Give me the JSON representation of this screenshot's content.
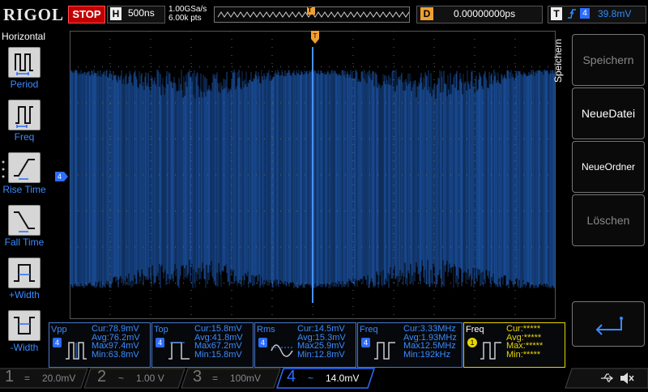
{
  "topbar": {
    "logo": "RIGOL",
    "run_state": "STOP",
    "h_label": "H",
    "timebase": "500ns",
    "sample_rate": "1.00GSa/s",
    "memory_depth": "6.00k pts",
    "trigger_marker": "T",
    "delay_label": "D",
    "delay_value": "0.00000000ps",
    "trigger_label": "T",
    "trigger_edge": "rising-edge-icon",
    "trigger_channel": "4",
    "trigger_level": "39.8mV"
  },
  "left_menu": {
    "title": "Horizontal",
    "items": [
      {
        "label": "Period",
        "icon": "period-icon"
      },
      {
        "label": "Freq",
        "icon": "frequency-icon"
      },
      {
        "label": "Rise Time",
        "icon": "rise-time-icon"
      },
      {
        "label": "Fall Time",
        "icon": "fall-time-icon"
      },
      {
        "label": "+Width",
        "icon": "positive-width-icon"
      },
      {
        "label": "-Width",
        "icon": "negative-width-icon"
      }
    ]
  },
  "channel_marker": "4",
  "right_menu": {
    "tab": "Speichern",
    "buttons": [
      {
        "label": "Speichern",
        "enabled": false
      },
      {
        "label": "NeueDatei",
        "enabled": true
      },
      {
        "label": "NeueOrdner",
        "enabled": true
      },
      {
        "label": "Löschen",
        "enabled": false
      }
    ],
    "enter_icon": "enter-return-icon"
  },
  "measurements": [
    {
      "name": "Vpp",
      "channel": "4",
      "cur": "Cur:78.9mV",
      "avg": "Avg:76.2mV",
      "max": "Max97.4mV",
      "min": "Min:63.8mV"
    },
    {
      "name": "Top",
      "channel": "4",
      "cur": "Cur:15.8mV",
      "avg": "Avg:41.8mV",
      "max": "Max67.2mV",
      "min": "Min:15.8mV"
    },
    {
      "name": "Rms",
      "channel": "4",
      "cur": "Cur:14.5mV",
      "avg": "Avg:15.3mV",
      "max": "Max25.9mV",
      "min": "Min:12.8mV"
    },
    {
      "name": "Freq",
      "channel": "4",
      "cur": "Cur:3.33MHz",
      "avg": "Avg:1.93MHz",
      "max": "Max12.5MHz",
      "min": "Min:192kHz"
    },
    {
      "name": "Freq",
      "channel": "1",
      "cur": "Cur:*****",
      "avg": "Avg:*****",
      "max": "Max:*****",
      "min": "Min:*****"
    }
  ],
  "channels": [
    {
      "num": "1",
      "coupling": "=",
      "scale": "20.0mV",
      "color": "#e8d600",
      "active": false
    },
    {
      "num": "2",
      "coupling": "~",
      "scale": "1.00 V",
      "color": "#18c4d8",
      "active": false
    },
    {
      "num": "3",
      "coupling": "=",
      "scale": "100mV",
      "color": "#d040c0",
      "active": false
    },
    {
      "num": "4",
      "coupling": "~",
      "scale": "14.0mV",
      "color": "#2d6cff",
      "active": true
    }
  ],
  "status_icons": [
    "usb-icon",
    "speaker-muted-icon"
  ],
  "colors": {
    "accent_blue": "#3b8bff",
    "stop_red": "#c00000",
    "trigger_orange": "#f0a030",
    "waveform": "#1a4f9c"
  }
}
